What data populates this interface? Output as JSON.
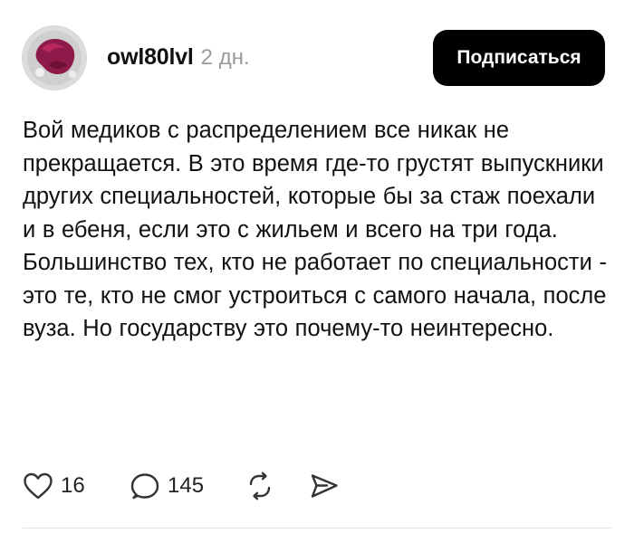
{
  "post": {
    "author": {
      "username": "owl80lvl",
      "timestamp": "2 дн."
    },
    "subscribe_label": "Подписаться",
    "text": "Вой медиков с распределением все никак не прекращается. В это время где-то грустят выпускники других специальностей, которые бы за стаж поехали и в ебеня, если это с жильем и всего на три года. Большинство тех, кто не работает по специальности - это те, кто не смог устроиться с самого начала, после вуза. Но государству это почему-то неинтересно.",
    "actions": {
      "likes": "16",
      "comments": "145"
    }
  },
  "icons": {
    "like": "heart-icon",
    "comment": "speech-bubble-icon",
    "repost": "repost-icon",
    "share": "send-icon"
  },
  "colors": {
    "button_background": "#000000",
    "button_text": "#ffffff",
    "timestamp": "#9a9a9a",
    "text": "#111111"
  }
}
